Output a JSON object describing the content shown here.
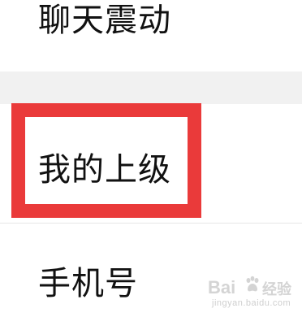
{
  "settings_list": {
    "items": [
      {
        "label": "聊天震动"
      },
      {
        "label": "我的上级"
      },
      {
        "label": "手机号"
      }
    ]
  },
  "highlight": {
    "target": "我的上级",
    "color": "#ea3a3a"
  },
  "watermark": {
    "logo_text": "Bai",
    "site_text": "经验",
    "url": "jingyan.baidu.com",
    "icon": "baidu-paw-icon"
  }
}
